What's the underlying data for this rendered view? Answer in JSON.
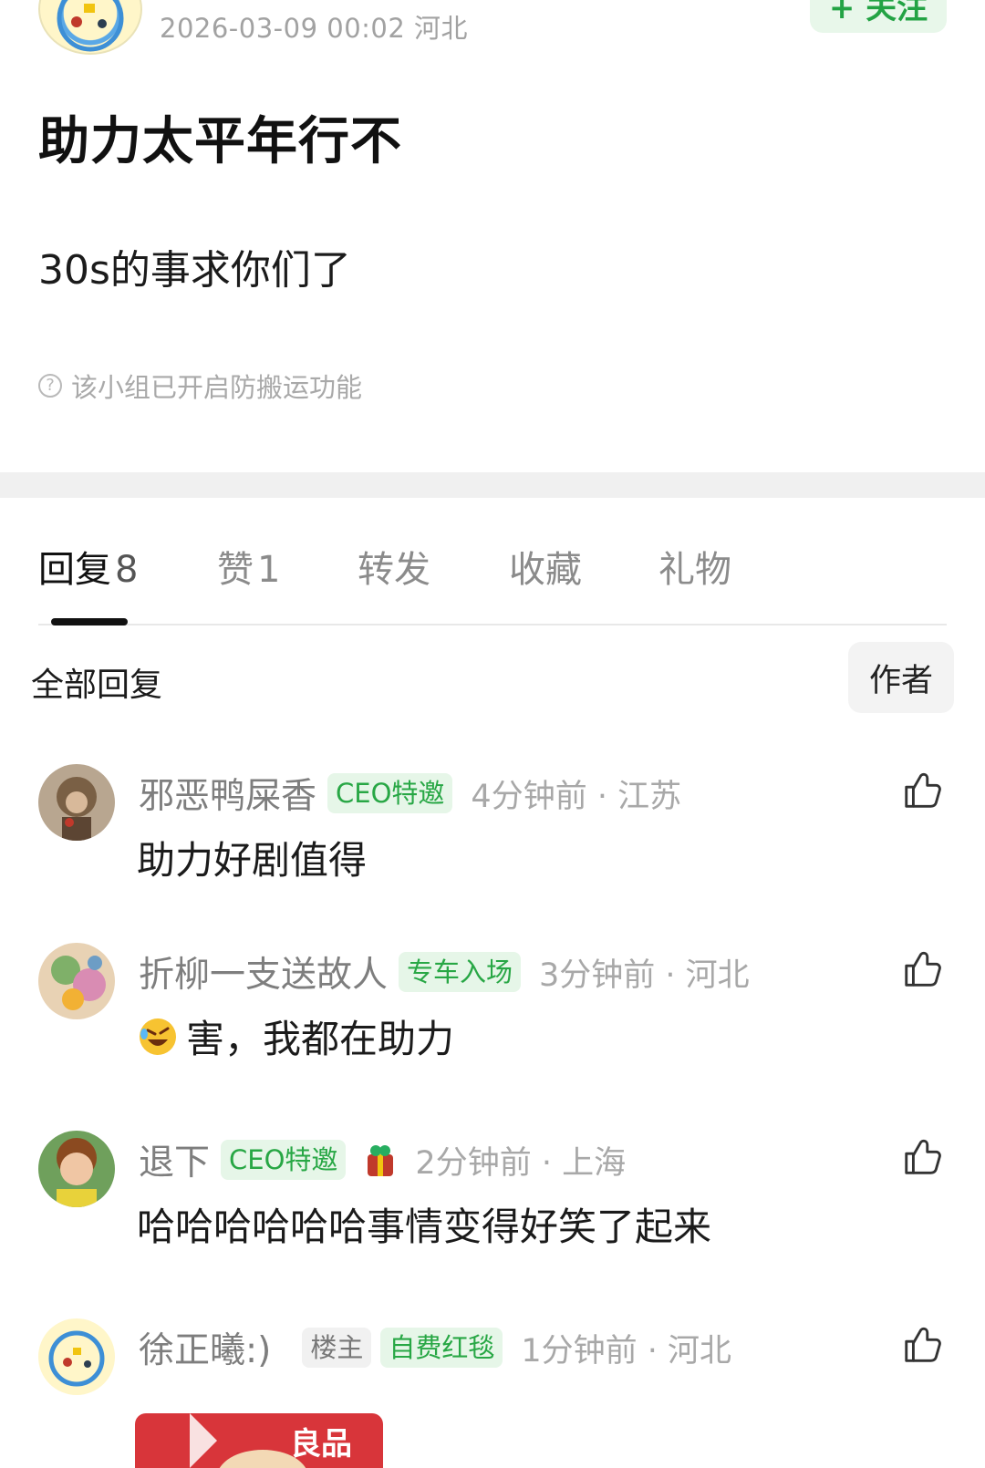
{
  "post": {
    "meta": "2026-03-09 00:02  河北",
    "follow_label": "+ 关注",
    "title": "助力太平年行不",
    "body": "30s的事求你们了",
    "notice": "该小组已开启防搬运功能"
  },
  "tabs": [
    {
      "label": "回复",
      "count": "8",
      "active": true
    },
    {
      "label": "赞",
      "count": "1",
      "active": false
    },
    {
      "label": "转发",
      "count": "",
      "active": false
    },
    {
      "label": "收藏",
      "count": "",
      "active": false
    },
    {
      "label": "礼物",
      "count": "",
      "active": false
    }
  ],
  "filter": {
    "all_label": "全部回复",
    "author_label": "作者"
  },
  "comments": [
    {
      "name": "邪恶鸭屎香",
      "badges": [
        "CEO特邀"
      ],
      "time": "4分钟前 · 江苏",
      "text": "助力好剧值得"
    },
    {
      "name": "折柳一支送故人",
      "badges": [
        "专车入场"
      ],
      "time": "3分钟前 · 河北",
      "text": "害，我都在助力",
      "emoji": "rofl-emoji"
    },
    {
      "name": "退下",
      "badges": [
        "CEO特邀"
      ],
      "gift": "gift-icon",
      "time": "2分钟前 · 上海",
      "text": "哈哈哈哈哈哈事情变得好笑了起来"
    },
    {
      "name": "徐正曦:)",
      "badges": [
        "楼主",
        "自费红毯"
      ],
      "time": "1分钟前 · 河北",
      "text": ""
    }
  ],
  "image_preview": {
    "text": "良品"
  },
  "colors": {
    "accent_green": "#28a745",
    "badge_bg": "#e6f6e8",
    "muted": "#a8a8a8"
  }
}
